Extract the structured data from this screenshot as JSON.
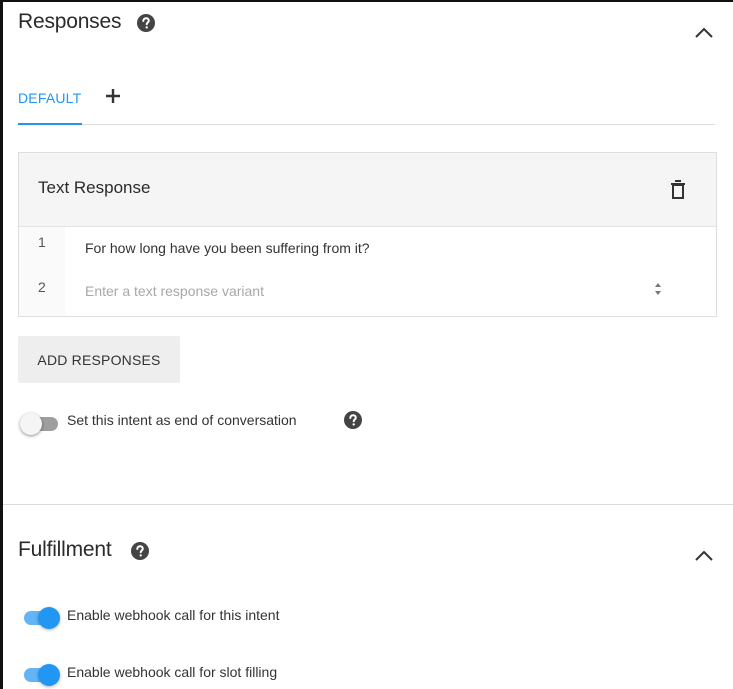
{
  "responses": {
    "title": "Responses",
    "tabs": [
      {
        "label": "DEFAULT",
        "active": true
      }
    ],
    "add_tab_icon": "plus-icon",
    "card": {
      "title": "Text Response",
      "delete_icon": "trash-icon",
      "rows": [
        {
          "number": "1",
          "text": "For how long have you been suffering from it?"
        },
        {
          "number": "2",
          "placeholder": "Enter a text response variant"
        }
      ]
    },
    "add_button_label": "ADD RESPONSES",
    "end_conversation": {
      "label": "Set this intent as end of conversation",
      "enabled": false
    }
  },
  "fulfillment": {
    "title": "Fulfillment",
    "webhook_intent": {
      "label": "Enable webhook call for this intent",
      "enabled": true
    },
    "webhook_slot": {
      "label": "Enable webhook call for slot filling",
      "enabled": true
    }
  },
  "colors": {
    "accent": "#2196f3",
    "accent_track": "#64b5f6",
    "help_icon": "#444444"
  }
}
